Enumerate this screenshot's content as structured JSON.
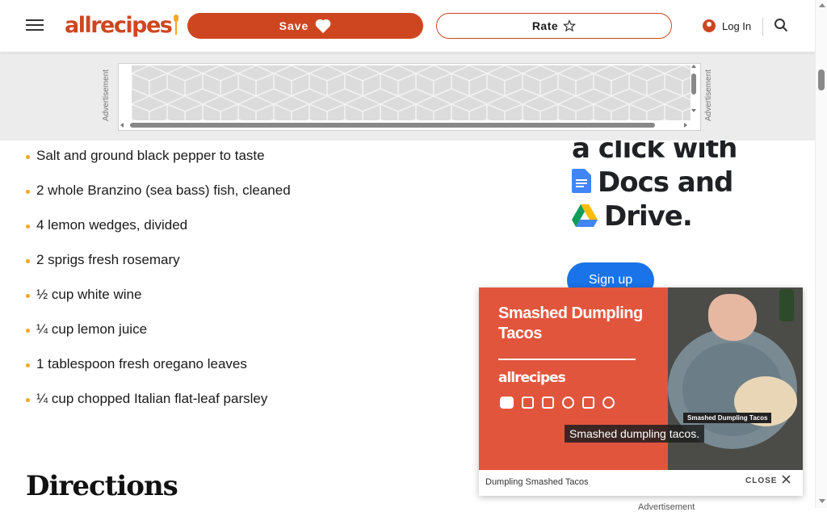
{
  "header": {
    "logo_text": "allrecipes",
    "save_label": "Save",
    "rate_label": "Rate",
    "login_label": "Log In"
  },
  "ad_banner": {
    "side_label": "Advertisement"
  },
  "google_ad": {
    "line1": "a click with",
    "line2": "Docs and",
    "line3": "Drive.",
    "signup_label": "Sign up"
  },
  "ingredients": [
    "Salt and ground black pepper to taste",
    "2 whole Branzino (sea bass) fish, cleaned",
    "4 lemon wedges, divided",
    "2 sprigs fresh rosemary",
    "½ cup white wine",
    "¼ cup lemon juice",
    "1 tablespoon fresh oregano leaves",
    "¼ cup chopped Italian flat-leaf parsley"
  ],
  "directions_title": "Directions",
  "video": {
    "title": "Smashed Dumpling Tacos",
    "brand": "allrecipes",
    "tag": "Smashed Dumpling Tacos",
    "caption": "Smashed dumpling tacos.",
    "footer_title": "Dumpling Smashed Tacos",
    "close_label": "CLOSE",
    "ad_label": "Advertisement"
  },
  "colors": {
    "brand": "#ce4620",
    "bullet": "#f5a623",
    "video_bg": "#e2553d",
    "google_blue": "#1a73e8"
  }
}
